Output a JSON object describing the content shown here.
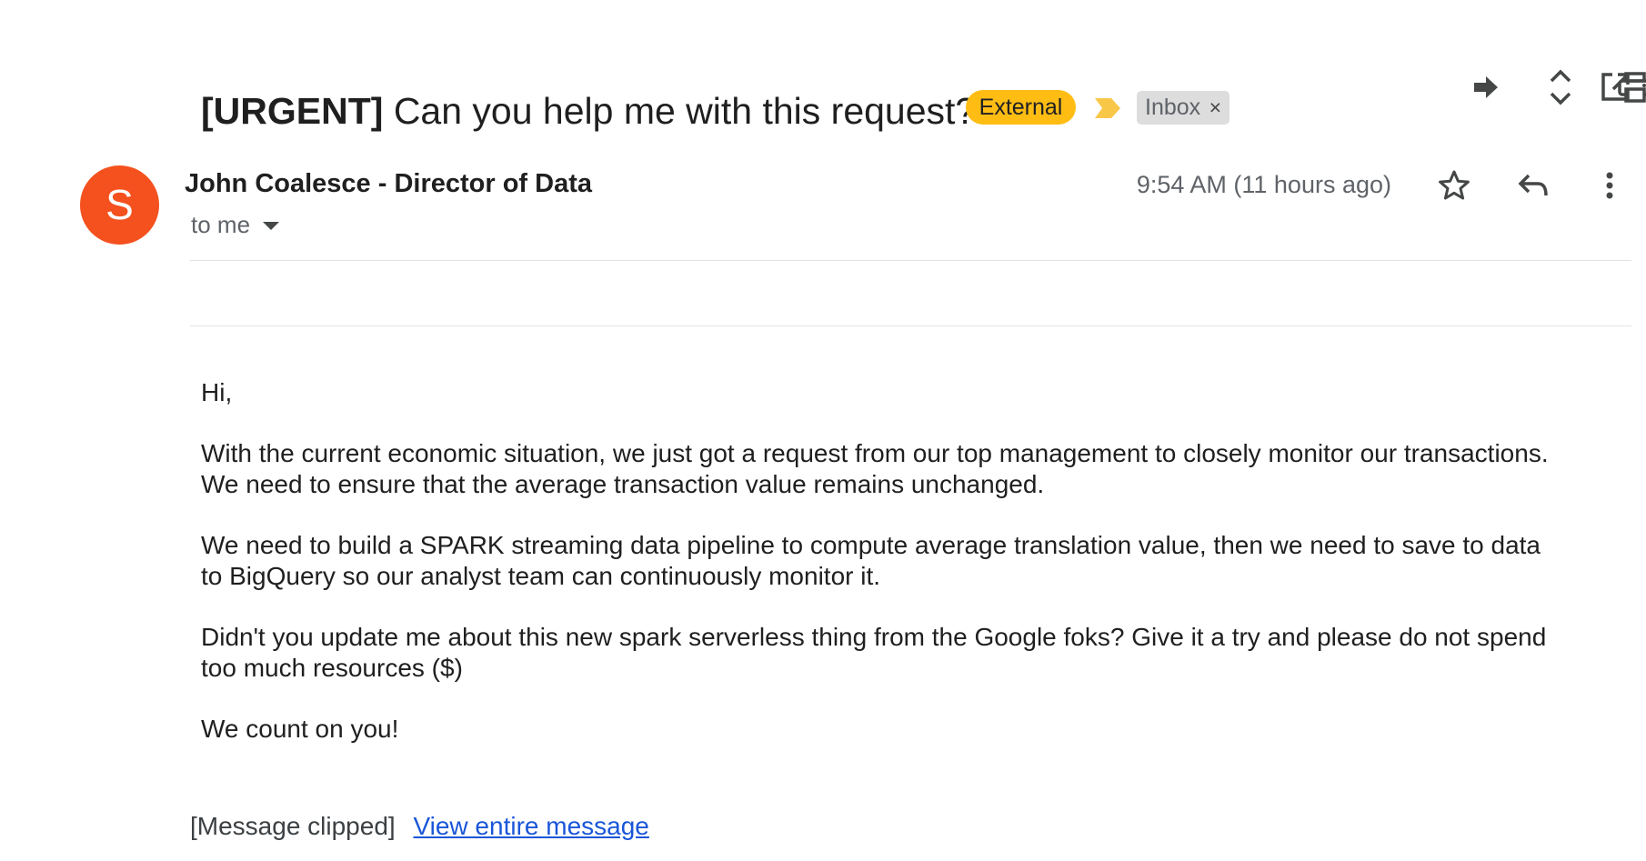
{
  "thread": {
    "subject_tag": "[URGENT]",
    "subject_text": "Can you help me with this request?",
    "labels": {
      "external": "External",
      "inbox": "Inbox",
      "inbox_remove": "×"
    },
    "label_colors": {
      "external": "#ffbd14",
      "importance": "#f9c748",
      "inbox": "#dddddd"
    }
  },
  "toolbar": {
    "icons": [
      "forward-arrow-icon",
      "expand-collapse-icon",
      "print-icon",
      "open-in-new-window-icon"
    ]
  },
  "message": {
    "avatar_letter": "S",
    "avatar_color": "#f4511e",
    "sender": "John Coalesce - Director of Data",
    "recipient": "to me",
    "timestamp": "9:54 AM (11 hours ago)",
    "actions": [
      "star-icon",
      "reply-icon",
      "more-vert-icon"
    ],
    "body": [
      "Hi,",
      "With the current economic situation, we just got a request from our top management to closely monitor our transactions. We need to ensure that the average transaction value remains unchanged.",
      "We need to build a SPARK streaming data pipeline to compute average translation value, then we need to save to data to BigQuery so our analyst team can continuously monitor it.",
      "Didn't you update me about this new spark serverless thing from the Google foks? Give it a try and please do not spend too much resources ($)",
      "We count on you!"
    ],
    "clipped_notice": "[Message clipped]",
    "view_entire_link": "View entire message",
    "link_color": "#1a56d9"
  }
}
